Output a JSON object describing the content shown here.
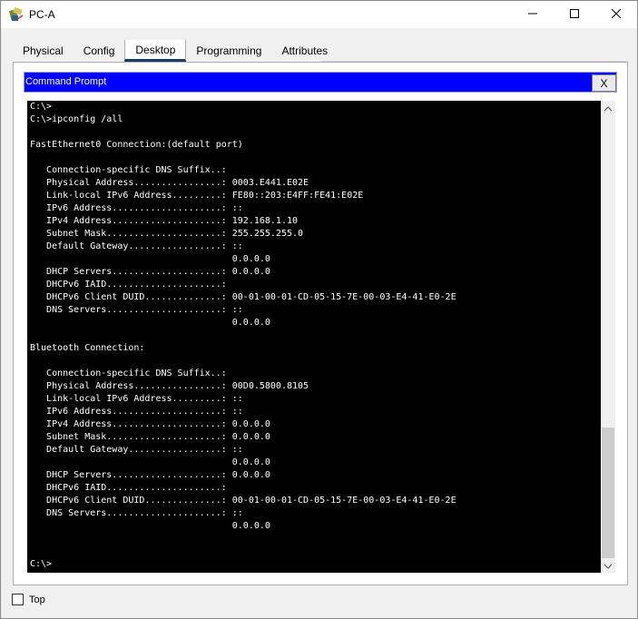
{
  "window": {
    "title": "PC-A",
    "icon": "packet-tracer-pc-icon",
    "controls": {
      "minimize": "minimize-icon",
      "maximize": "maximize-icon",
      "close": "close-icon"
    }
  },
  "tabs": [
    {
      "label": "Physical",
      "active": false
    },
    {
      "label": "Config",
      "active": false
    },
    {
      "label": "Desktop",
      "active": true
    },
    {
      "label": "Programming",
      "active": false
    },
    {
      "label": "Attributes",
      "active": false
    }
  ],
  "command_prompt": {
    "title": "Command Prompt",
    "close_label": "X",
    "lines": [
      "C:\\>",
      "C:\\>ipconfig /all",
      "",
      "FastEthernet0 Connection:(default port)",
      "",
      "   Connection-specific DNS Suffix..:",
      "   Physical Address................: 0003.E441.E02E",
      "   Link-local IPv6 Address.........: FE80::203:E4FF:FE41:E02E",
      "   IPv6 Address....................: ::",
      "   IPv4 Address....................: 192.168.1.10",
      "   Subnet Mask.....................: 255.255.255.0",
      "   Default Gateway.................: ::",
      "                                     0.0.0.0",
      "   DHCP Servers....................: 0.0.0.0",
      "   DHCPv6 IAID.....................: ",
      "   DHCPv6 Client DUID..............: 00-01-00-01-CD-05-15-7E-00-03-E4-41-E0-2E",
      "   DNS Servers.....................: ::",
      "                                     0.0.0.0",
      "",
      "Bluetooth Connection:",
      "",
      "   Connection-specific DNS Suffix..:",
      "   Physical Address................: 00D0.5800.8105",
      "   Link-local IPv6 Address.........: ::",
      "   IPv6 Address....................: ::",
      "   IPv4 Address....................: 0.0.0.0",
      "   Subnet Mask.....................: 0.0.0.0",
      "   Default Gateway.................: ::",
      "                                     0.0.0.0",
      "   DHCP Servers....................: 0.0.0.0",
      "   DHCPv6 IAID.....................: ",
      "   DHCPv6 Client DUID..............: 00-01-00-01-CD-05-15-7E-00-03-E4-41-E0-2E",
      "   DNS Servers.....................: ::",
      "                                     0.0.0.0",
      "",
      "",
      "C:\\>"
    ]
  },
  "scrollbar": {
    "up_icon": "scroll-up-arrow-icon",
    "down_icon": "scroll-down-arrow-icon"
  },
  "footer": {
    "top_checkbox_label": "Top",
    "top_checked": false
  },
  "colors": {
    "header_blue": "#0000ff",
    "terminal_bg": "#000000",
    "terminal_fg": "#ffffff",
    "active_tab_underline": "#173e67"
  }
}
